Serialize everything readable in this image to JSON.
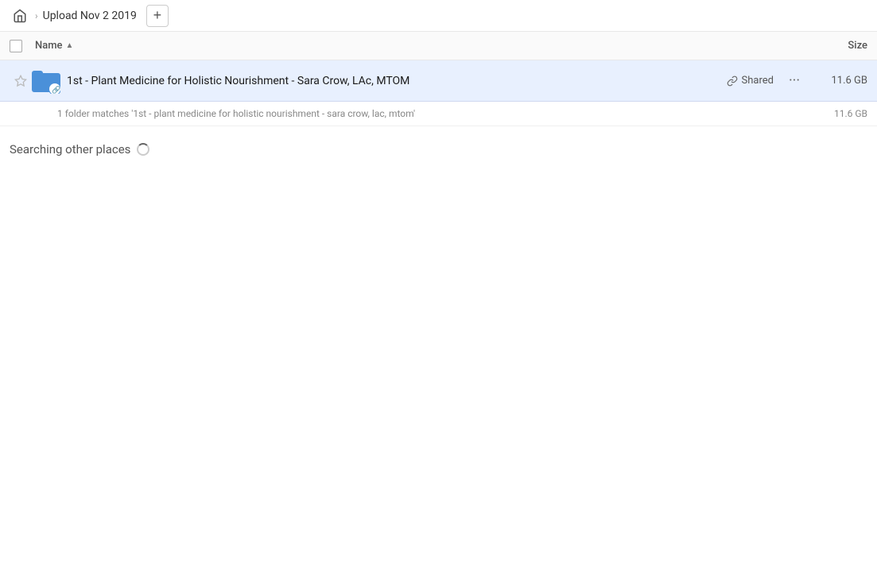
{
  "breadcrumb": {
    "home_icon": "🏠",
    "separator": "›",
    "title": "Upload Nov 2 2019",
    "add_button_label": "+"
  },
  "columns": {
    "name_label": "Name",
    "size_label": "Size"
  },
  "file_row": {
    "name": "1st - Plant Medicine for Holistic Nourishment - Sara Crow, LAc, MTOM",
    "shared_label": "Shared",
    "size": "11.6 GB",
    "more_label": "···"
  },
  "match_info": {
    "text": "1 folder matches '1st - plant medicine for holistic nourishment - sara crow, lac, mtom'",
    "size": "11.6 GB"
  },
  "searching": {
    "text": "Searching other places"
  }
}
